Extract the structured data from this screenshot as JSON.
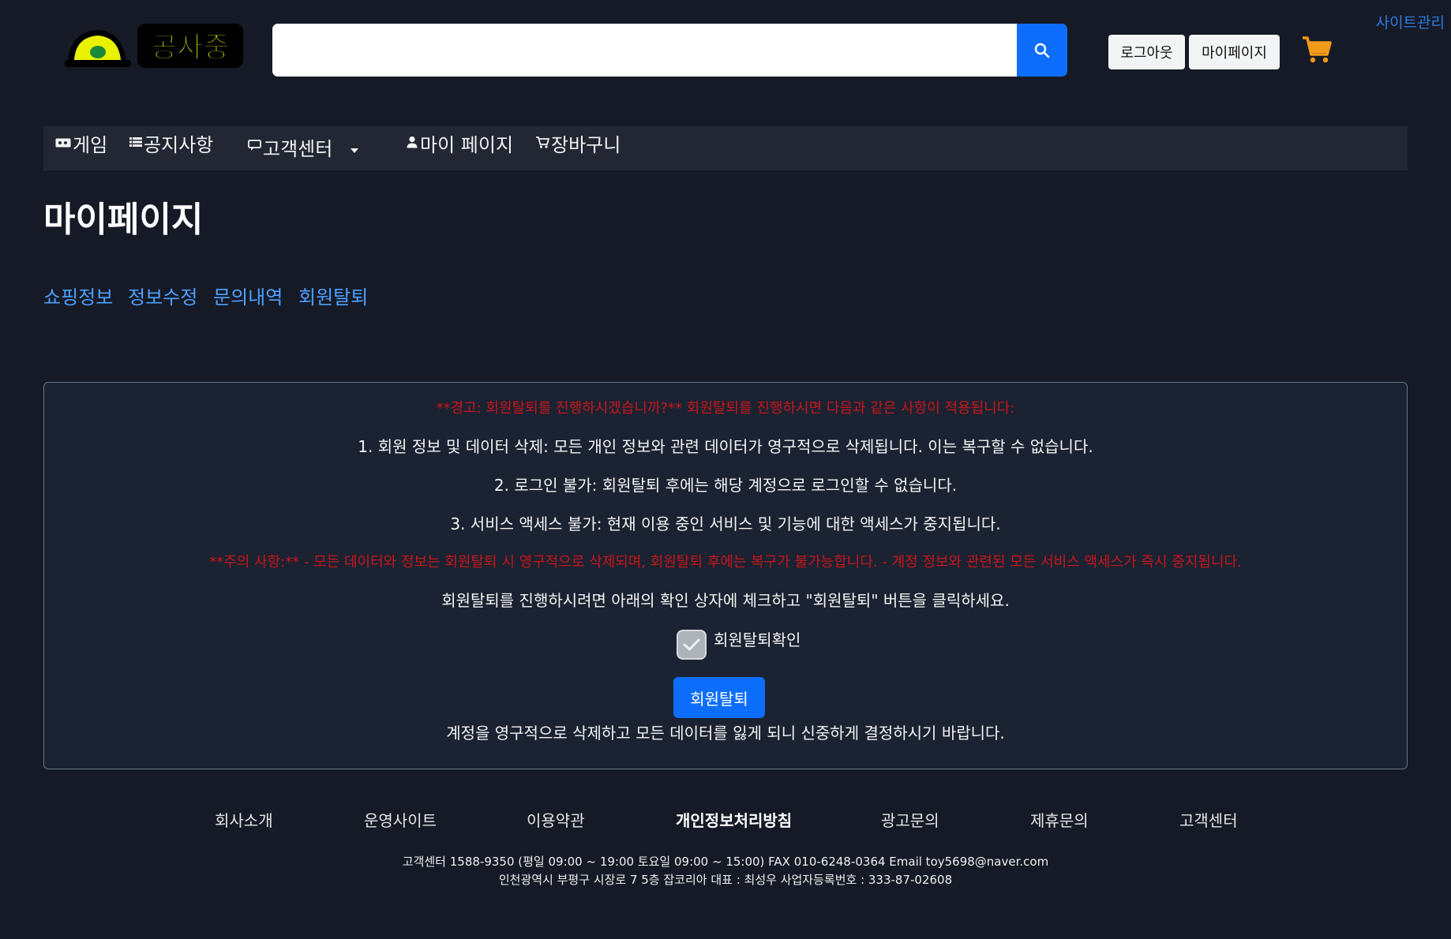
{
  "header": {
    "logo_text": "공사중",
    "search_placeholder": "",
    "logout_label": "로그아웃",
    "mypage_label": "마이페이지",
    "site_admin_label": "사이트관리"
  },
  "nav": {
    "items": [
      {
        "icon": "ticket-icon",
        "label": "게임"
      },
      {
        "icon": "list-icon",
        "label": "공지사항"
      },
      {
        "icon": "chat-icon",
        "label": "고객센터"
      },
      {
        "icon": "person-icon",
        "label": "마이 페이지"
      },
      {
        "icon": "cart-icon",
        "label": "장바구니"
      }
    ]
  },
  "page": {
    "title": "마이페이지",
    "tabs": [
      "쇼핑정보",
      "정보수정",
      "문의내역",
      "회원탈퇴"
    ]
  },
  "withdraw": {
    "warning_1": "**경고: 회원탈퇴를 진행하시겠습니까?** 회원탈퇴를 진행하시면 다음과 같은 사항이 적용됩니다:",
    "item_1": "1. 회원 정보 및 데이터 삭제: 모든 개인 정보와 관련 데이터가 영구적으로 삭제됩니다. 이는 복구할 수 없습니다.",
    "item_2": "2. 로그인 불가: 회원탈퇴 후에는 해당 계정으로 로그인할 수 없습니다.",
    "item_3": "3. 서비스 액세스 불가: 현재 이용 중인 서비스 및 기능에 대한 액세스가 중지됩니다.",
    "warning_2": "**주의 사항:** - 모든 데이터와 정보는 회원탈퇴 시 영구적으로 삭제되며, 회원탈퇴 후에는 복구가 불가능합니다. - 계정 정보와 관련된 모든 서비스 액세스가 즉시 중지됩니다.",
    "instruction": "회원탈퇴를 진행하시려면 아래의 확인 상자에 체크하고 \"회원탈퇴\" 버튼을 클릭하세요.",
    "checkbox_label": "회원탈퇴확인",
    "checkbox_checked": true,
    "button_label": "회원탈퇴",
    "footer_note": "계정을 영구적으로 삭제하고 모든 데이터를 잃게 되니 신중하게 결정하시기 바랍니다."
  },
  "footer": {
    "links": [
      "회사소개",
      "운영사이트",
      "이용약관",
      "개인정보처리방침",
      "광고문의",
      "제휴문의",
      "고객센터"
    ],
    "info_1": "고객센터 1588-9350 (평일 09:00 ~ 19:00 토요일 09:00 ~ 15:00) FAX 010-6248-0364 Email toy5698@naver.com",
    "info_2": "인천광역시 부평구 시장로 7 5층 잡코리아 대표 : 최성우 사업자등록번호 : 333-87-02608"
  },
  "colors": {
    "background": "#151a26",
    "accent": "#0d6efd",
    "warning": "#c8161c",
    "tab_link": "#4ea1ff"
  }
}
